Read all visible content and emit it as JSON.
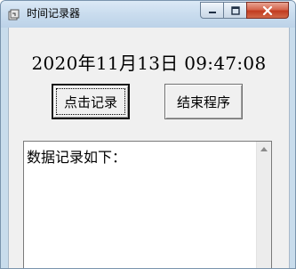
{
  "window": {
    "title": "时间记录器",
    "icons": {
      "app": "app-icon",
      "minimize": "minimize-icon",
      "maximize": "maximize-icon",
      "close": "close-icon"
    },
    "close_color": "#c23b20"
  },
  "main": {
    "datetime": "2020年11月13日 09:47:08",
    "record_button": "点击记录",
    "exit_button": "结束程序",
    "log_text": "数据记录如下："
  },
  "scrollbar": {
    "up_icon": "scroll-up-arrow-icon"
  }
}
